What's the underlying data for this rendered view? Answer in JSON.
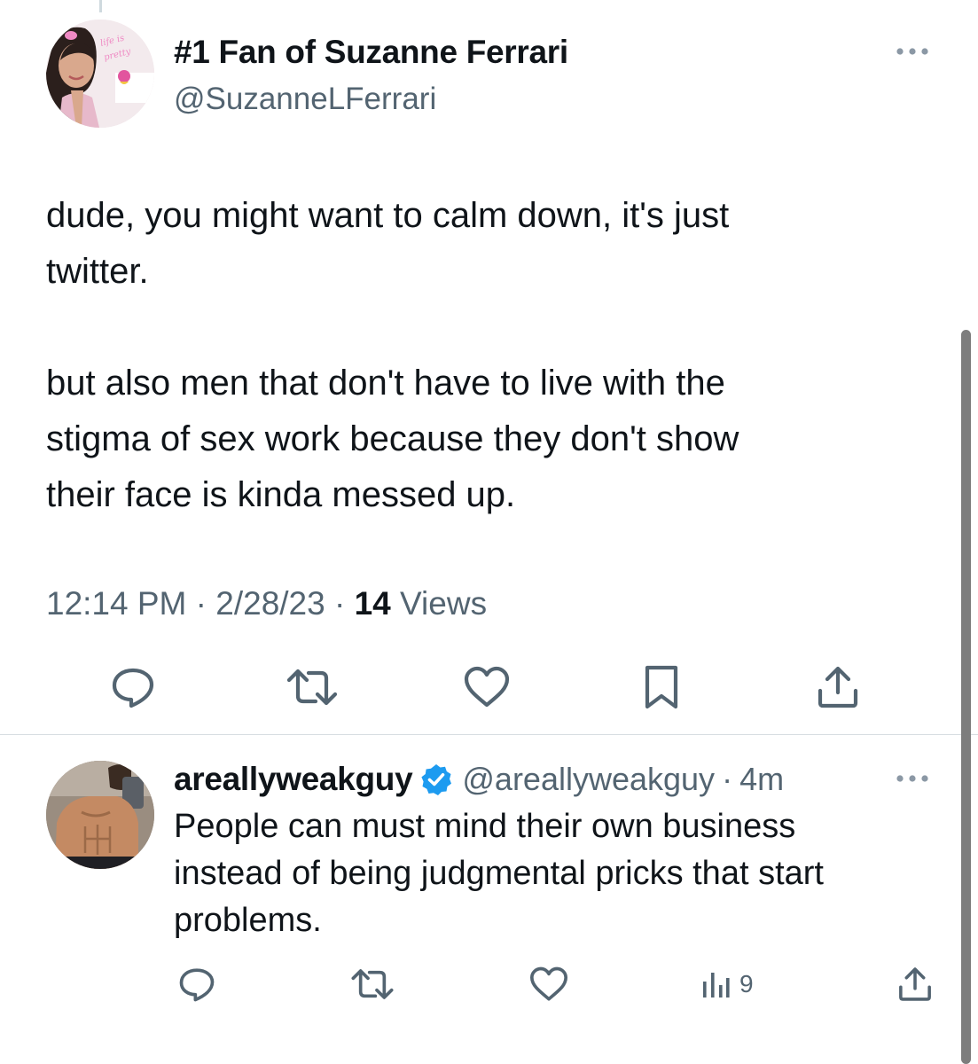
{
  "main_tweet": {
    "display_name": "#1 Fan of Suzanne Ferrari",
    "handle": "@SuzanneLFerrari",
    "avatar_neon_text": "life is better with pretty",
    "text_lines": [
      "dude, you might want to calm down, it's just",
      "twitter.",
      "",
      "but also men that don't have to live with the",
      "stigma of sex work because they don't show",
      "their face is kinda messed up."
    ],
    "time": "12:14 PM",
    "date": "2/28/23",
    "views_count": "14",
    "views_label": "Views",
    "separator": "·",
    "actions": [
      "reply-icon",
      "retweet-icon",
      "like-icon",
      "bookmark-icon",
      "share-icon"
    ]
  },
  "reply": {
    "display_name": "areallyweakguy",
    "verified": true,
    "handle": "@areallyweakguy",
    "separator": "·",
    "time": "4m",
    "text_lines": [
      "People can must mind their own business",
      "instead of being judgmental pricks that start",
      "problems."
    ],
    "view_count": "9",
    "actions": [
      "reply-icon",
      "retweet-icon",
      "like-icon",
      "views-icon",
      "share-icon"
    ]
  },
  "colors": {
    "text": "#0f1419",
    "secondary": "#536471",
    "verified_blue": "#1d9bf0",
    "divider": "#d7dde1"
  }
}
